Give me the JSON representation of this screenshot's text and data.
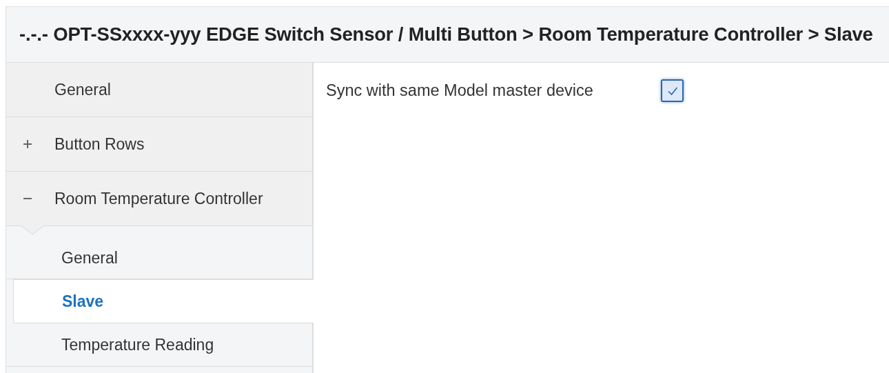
{
  "header": {
    "title": "-.-.- OPT-SSxxxx-yyy EDGE Switch Sensor / Multi Button > Room Temperature Controller > Slave"
  },
  "sidebar": {
    "items": [
      {
        "kind": "page",
        "label": "General",
        "selected": false
      },
      {
        "kind": "group",
        "label": "Button Rows",
        "selected": false,
        "expanded": false
      },
      {
        "kind": "group",
        "label": "Room Temperature Controller",
        "selected": false,
        "expanded": true,
        "children": [
          {
            "label": "General",
            "selected": false
          },
          {
            "label": "Slave",
            "selected": true
          },
          {
            "label": "Temperature Reading",
            "selected": false
          }
        ]
      }
    ]
  },
  "settings": [
    {
      "kind": "checkbox",
      "label": "Sync with same Model master device",
      "checked": true
    }
  ]
}
